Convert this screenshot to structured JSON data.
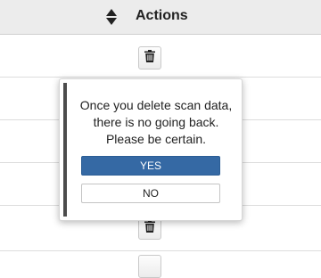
{
  "table": {
    "header": {
      "sort_icon": "sort-up-down-icon",
      "actions_label": "Actions"
    },
    "row_action_icon": "trash-icon"
  },
  "confirm_popover": {
    "message": "Once you delete scan data, there is no going back. Please be certain.",
    "yes_label": "YES",
    "no_label": "NO"
  },
  "colors": {
    "header_bg": "#ececec",
    "yes_button_bg": "#3569a4",
    "accent_bar": "#4c4c4c"
  }
}
